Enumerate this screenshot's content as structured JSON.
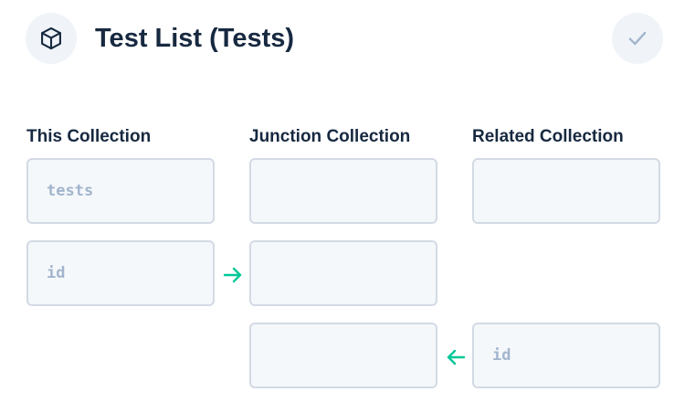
{
  "header": {
    "title": "Test List (Tests)",
    "icon": "box-icon",
    "save_icon": "check-icon"
  },
  "columns": {
    "this_collection": {
      "label": "This Collection",
      "collection_value": "tests",
      "field_value": "id"
    },
    "junction_collection": {
      "label": "Junction Collection",
      "collection_value": "",
      "field_this_value": "",
      "field_related_value": ""
    },
    "related_collection": {
      "label": "Related Collection",
      "collection_value": "",
      "field_value": "id"
    }
  },
  "colors": {
    "title": "#172940",
    "arrow": "#00c897",
    "input_border": "#d3dae4",
    "input_bg": "#f5f8fb",
    "input_text": "#a2b5cd",
    "button_bg": "#f0f4f9"
  }
}
